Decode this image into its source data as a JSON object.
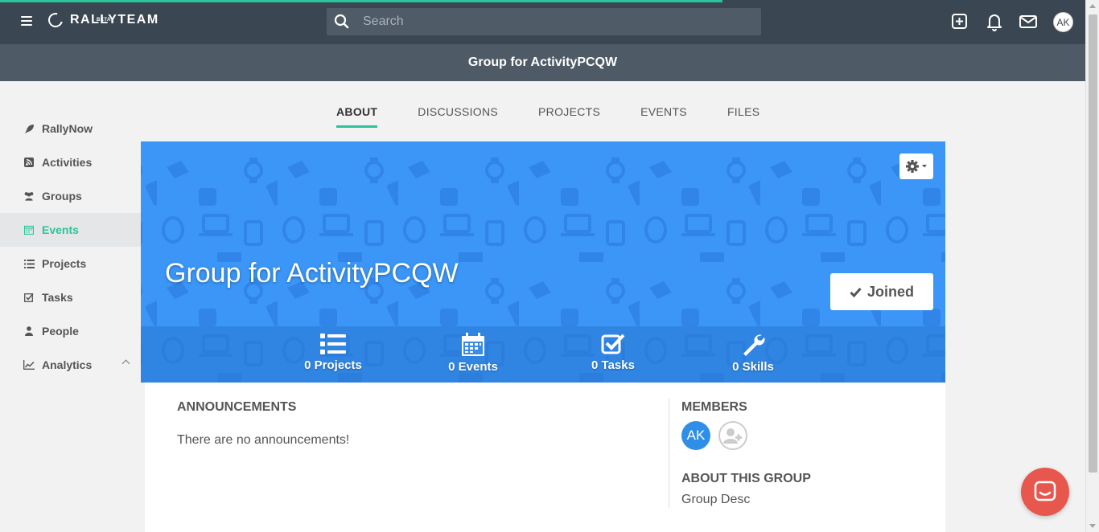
{
  "topbar": {
    "logo_text": "RALLYTEAM",
    "logo_badge": "BETA",
    "search_placeholder": "Search",
    "avatar_initials": "AK"
  },
  "page_title": "Group for ActivityPCQW",
  "sidebar": {
    "items": [
      {
        "label": "RallyNow",
        "icon": "rocket-icon"
      },
      {
        "label": "Activities",
        "icon": "rss-icon"
      },
      {
        "label": "Groups",
        "icon": "users-icon"
      },
      {
        "label": "Events",
        "icon": "calendar-icon",
        "active": true
      },
      {
        "label": "Projects",
        "icon": "list-icon"
      },
      {
        "label": "Tasks",
        "icon": "checkbox-icon"
      },
      {
        "label": "People",
        "icon": "user-icon"
      },
      {
        "label": "Analytics",
        "icon": "chart-line-icon",
        "expandable": true
      }
    ]
  },
  "tabs": [
    {
      "label": "ABOUT",
      "active": true
    },
    {
      "label": "DISCUSSIONS"
    },
    {
      "label": "PROJECTS"
    },
    {
      "label": "EVENTS"
    },
    {
      "label": "FILES"
    }
  ],
  "banner": {
    "title": "Group for ActivityPCQW",
    "joined_label": "Joined",
    "background_color": "#3b96f7",
    "stats": [
      {
        "label": "0 Projects",
        "icon": "list-icon"
      },
      {
        "label": "0 Events",
        "icon": "calendar-icon"
      },
      {
        "label": "0 Tasks",
        "icon": "checkbox-icon"
      },
      {
        "label": "0 Skills",
        "icon": "wrench-icon"
      }
    ]
  },
  "announcements": {
    "heading": "ANNOUNCEMENTS",
    "empty_text": "There are no announcements!"
  },
  "members": {
    "heading": "MEMBERS",
    "avatars": [
      "AK"
    ]
  },
  "about_group": {
    "heading": "ABOUT THIS GROUP",
    "text": "Group Desc"
  },
  "colors": {
    "accent": "#2dc39a",
    "topbar": "#3a4753",
    "chat_button": "#e8574e"
  }
}
